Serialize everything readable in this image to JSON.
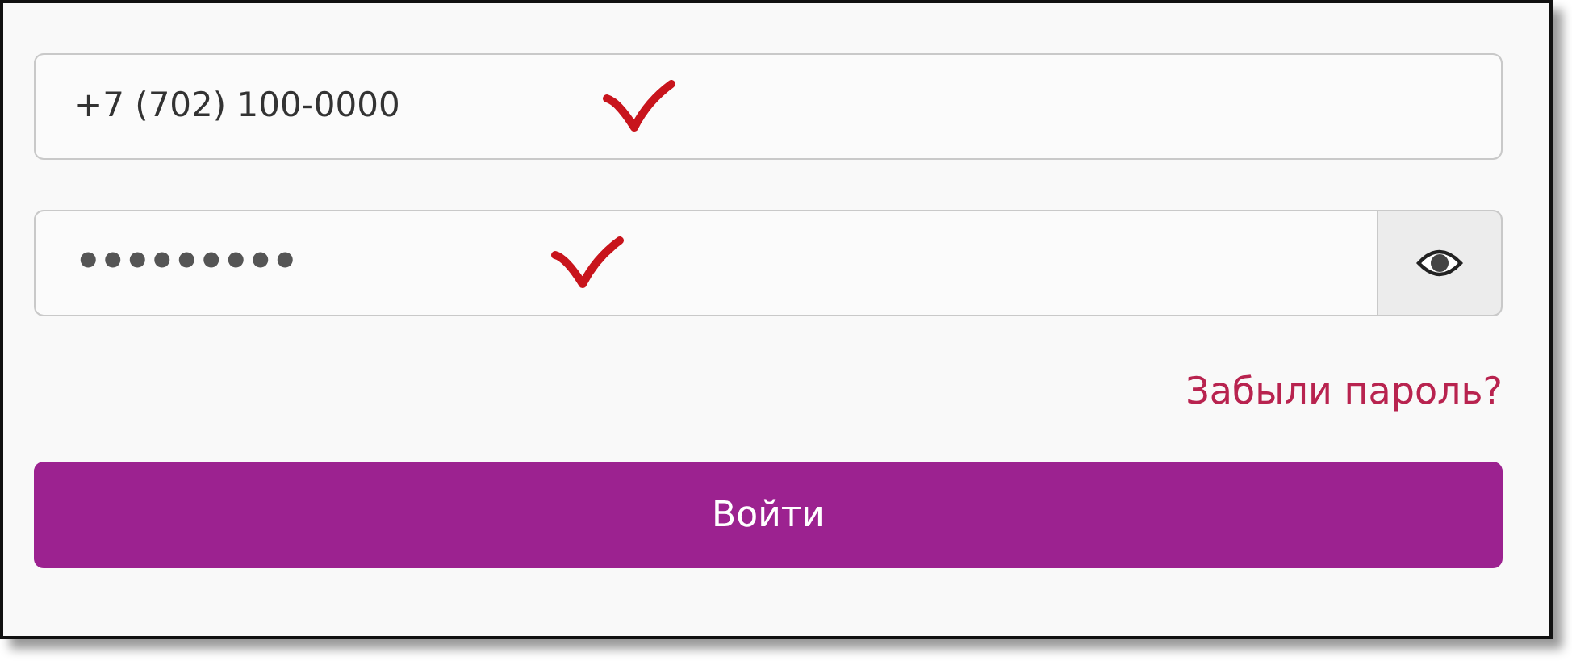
{
  "phone_field": {
    "value": "+7 (702) 100-0000",
    "annotation_tick": true
  },
  "password_field": {
    "value": "•••••••••",
    "annotation_tick": true
  },
  "forgot_link": "Забыли пароль?",
  "login_button": "Войти"
}
